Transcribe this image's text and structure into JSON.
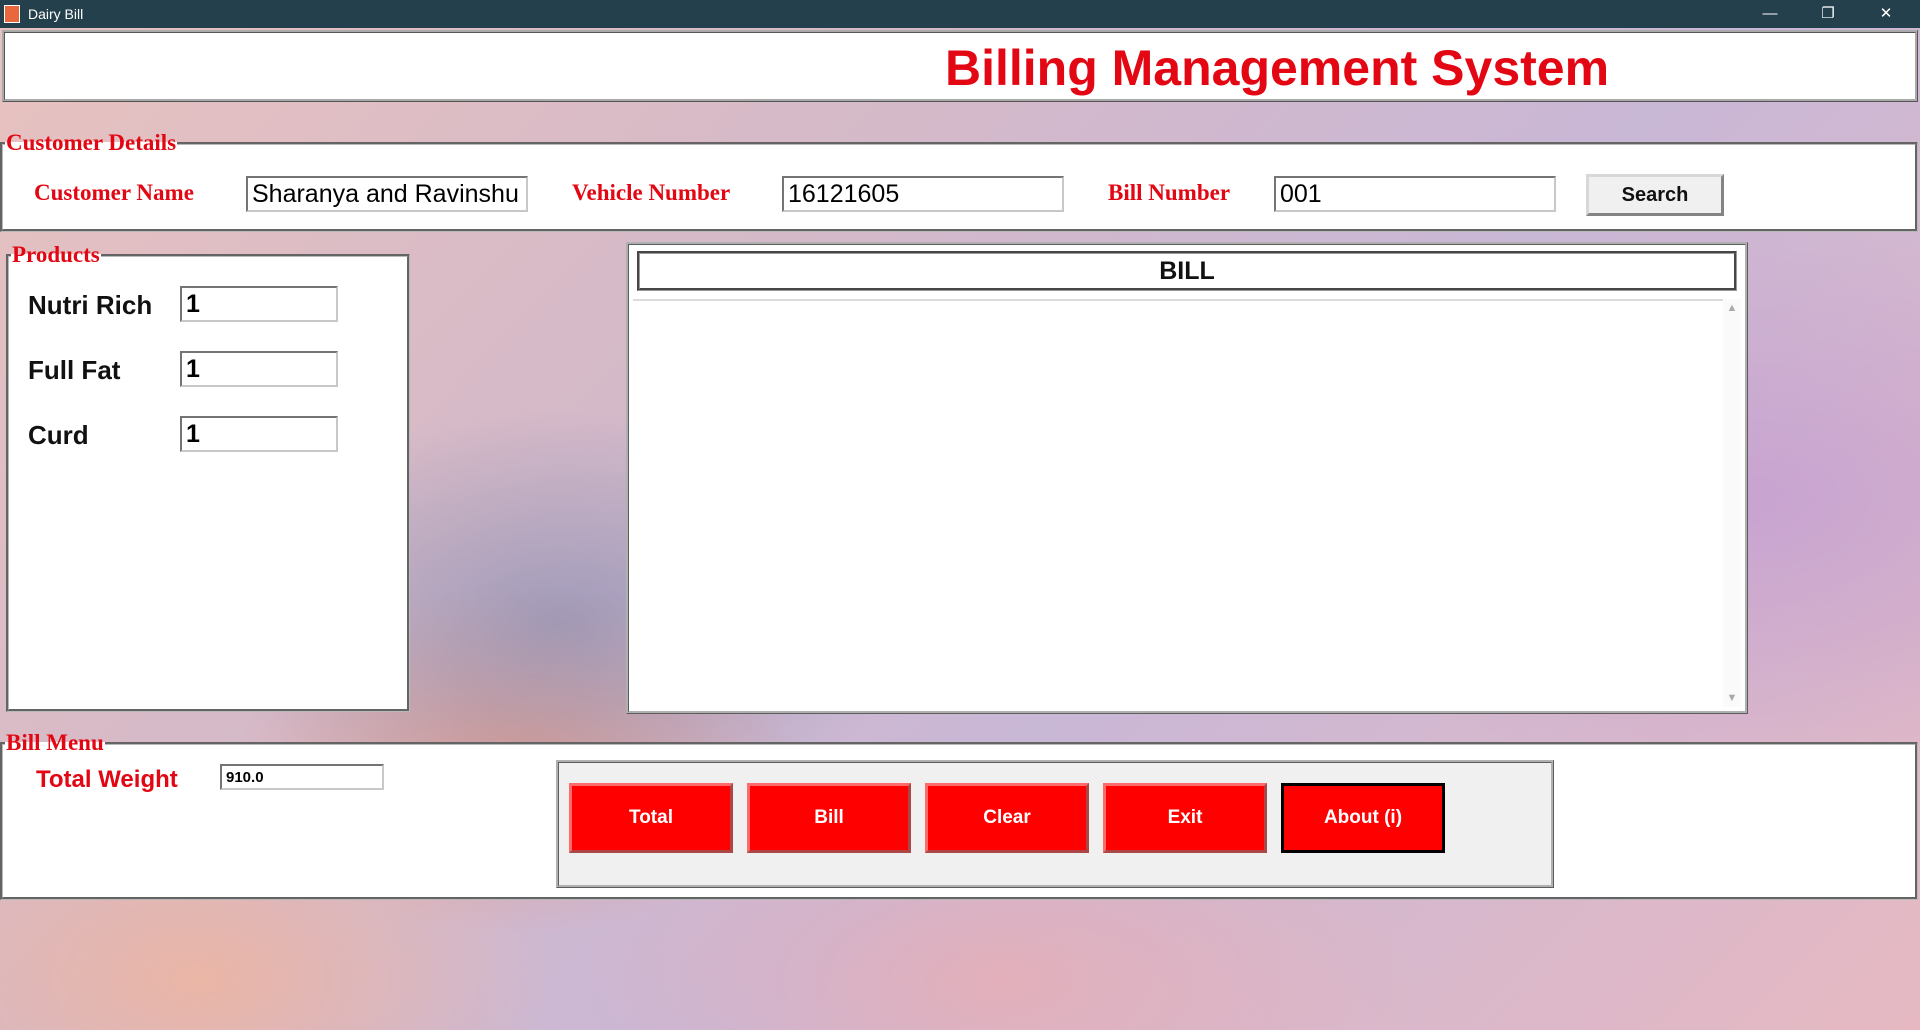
{
  "window": {
    "title": "Dairy Bill",
    "controls": {
      "minimize": "—",
      "maximize": "❐",
      "close": "✕"
    }
  },
  "header": {
    "title": "Billing Management System"
  },
  "customer_details": {
    "legend": "Customer Details",
    "customer_name_label": "Customer Name",
    "customer_name_value": "Sharanya and Ravinshu",
    "vehicle_number_label": "Vehicle Number",
    "vehicle_number_value": "16121605",
    "bill_number_label": "Bill Number",
    "bill_number_value": "001",
    "search_label": "Search"
  },
  "products": {
    "legend": "Products",
    "items": [
      {
        "label": "Nutri Rich",
        "value": "1"
      },
      {
        "label": "Full Fat",
        "value": "1"
      },
      {
        "label": "Curd",
        "value": "1"
      }
    ]
  },
  "bill_area": {
    "heading": "BILL",
    "content": ""
  },
  "bill_menu": {
    "legend": "Bill Menu",
    "total_weight_label": "Total Weight",
    "total_weight_value": "910.0",
    "buttons": [
      "Total",
      "Bill",
      "Clear",
      "Exit",
      "About (i)"
    ]
  },
  "colors": {
    "accent": "#e30613",
    "button_red": "#ff0000",
    "titlebar": "#24404d"
  }
}
